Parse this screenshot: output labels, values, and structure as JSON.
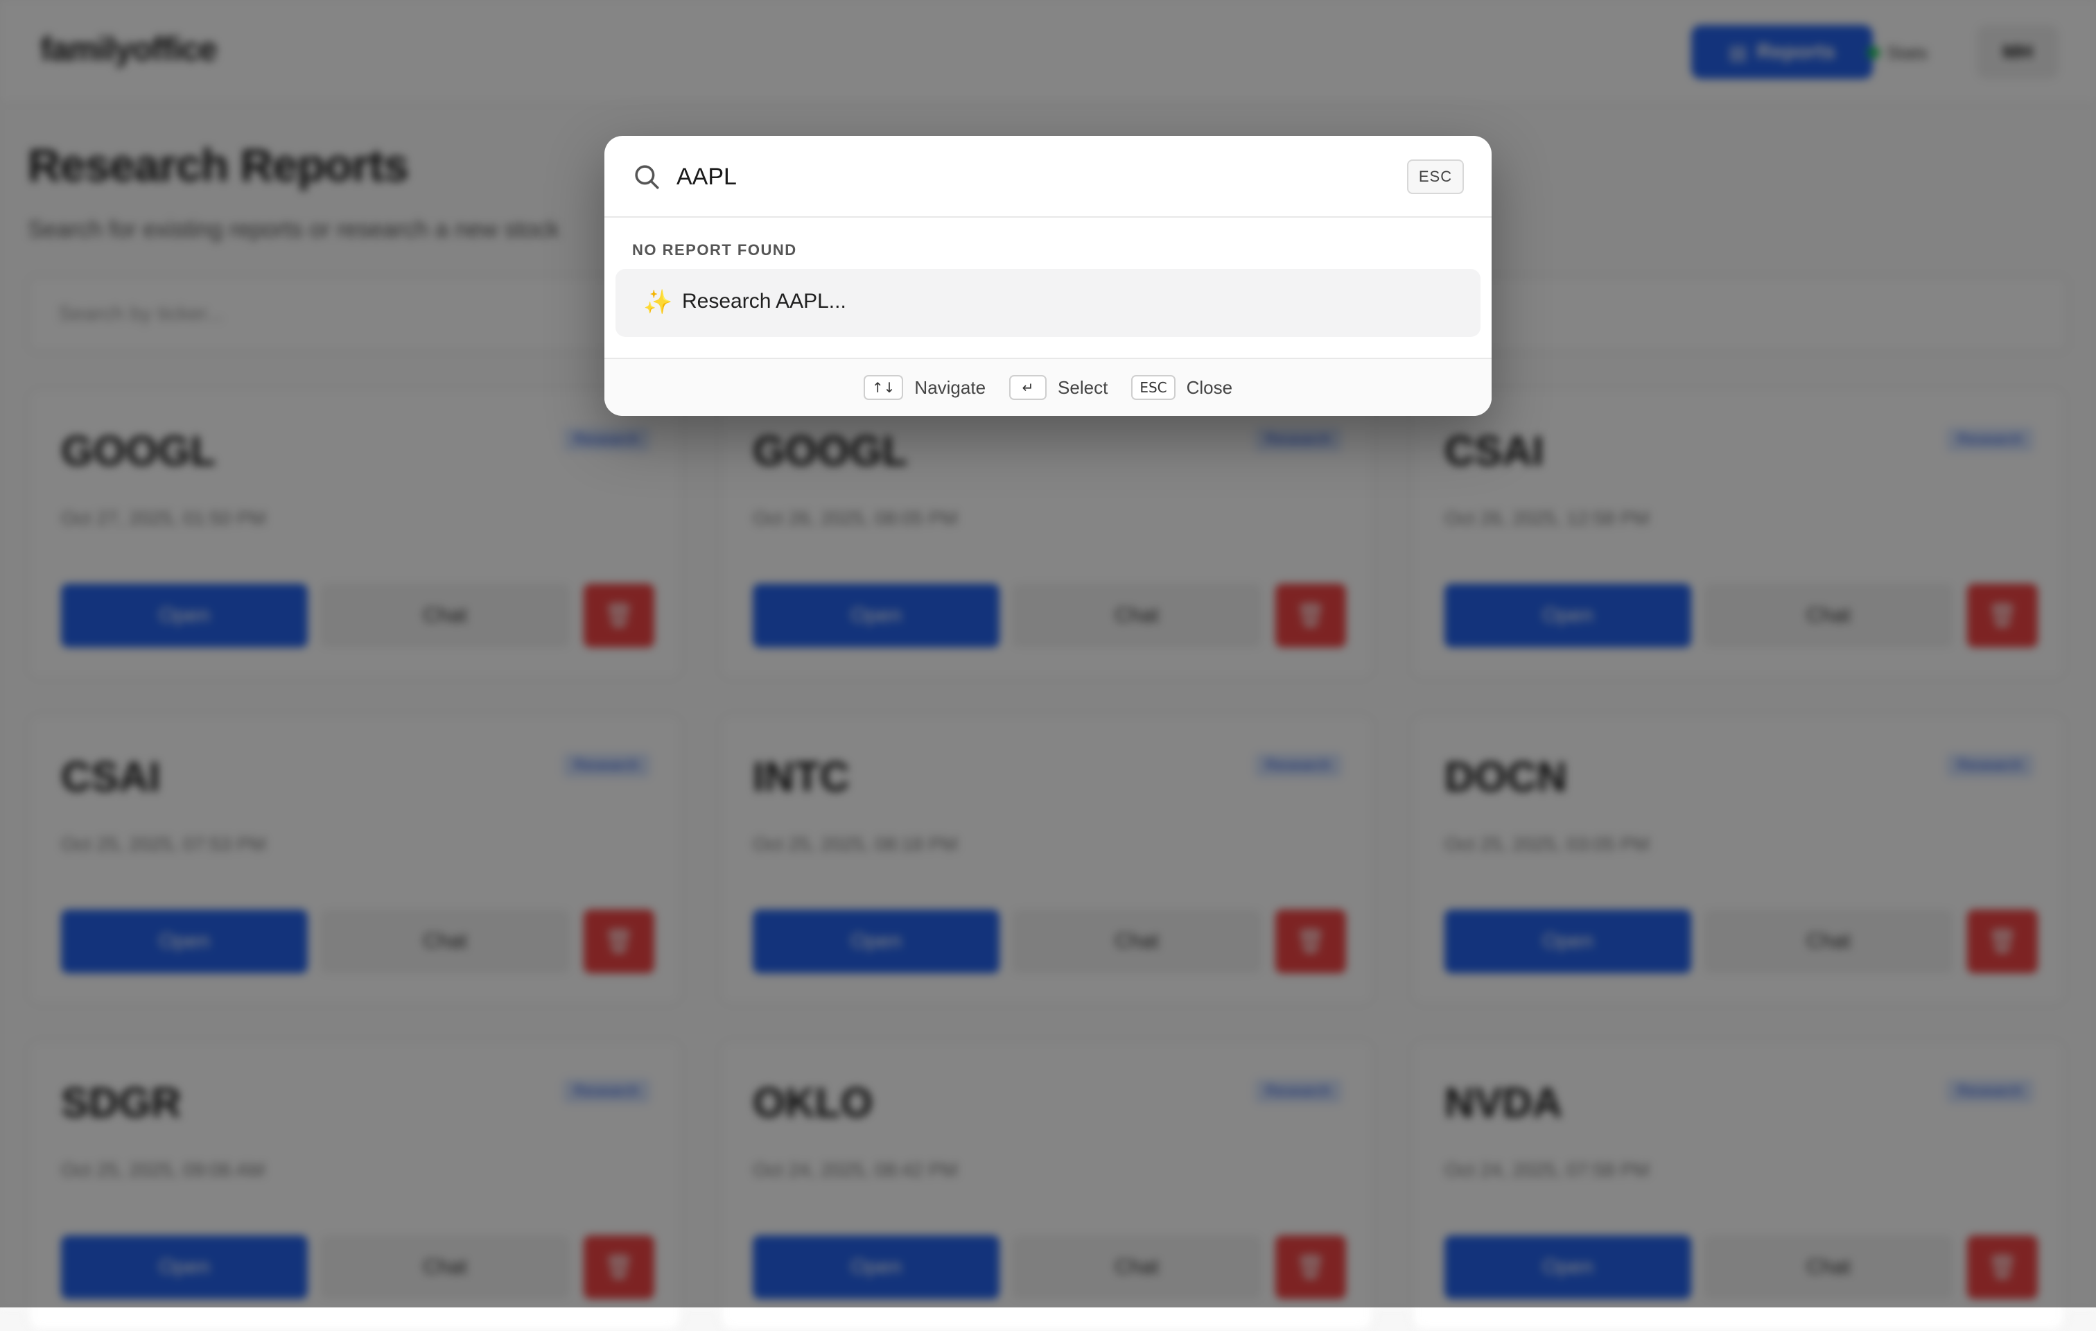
{
  "header": {
    "brand": "familyoffice",
    "reports_label": "Reports",
    "status_label": "Stats",
    "avatar_initials": "MH"
  },
  "page": {
    "title": "Research Reports",
    "subtitle": "Search for existing reports or research a new stock",
    "search_placeholder": "Search by ticker..."
  },
  "cards": [
    {
      "ticker": "GOOGL",
      "badge": "Research",
      "date": "Oct 27, 2025, 01:50 PM",
      "open": "Open",
      "chat": "Chat"
    },
    {
      "ticker": "GOOGL",
      "badge": "Research",
      "date": "Oct 26, 2025, 08:05 PM",
      "open": "Open",
      "chat": "Chat"
    },
    {
      "ticker": "CSAI",
      "badge": "Research",
      "date": "Oct 26, 2025, 12:58 PM",
      "open": "Open",
      "chat": "Chat"
    },
    {
      "ticker": "CSAI",
      "badge": "Research",
      "date": "Oct 25, 2025, 07:53 PM",
      "open": "Open",
      "chat": "Chat"
    },
    {
      "ticker": "INTC",
      "badge": "Research",
      "date": "Oct 25, 2025, 08:18 PM",
      "open": "Open",
      "chat": "Chat"
    },
    {
      "ticker": "DOCN",
      "badge": "Research",
      "date": "Oct 25, 2025, 03:05 PM",
      "open": "Open",
      "chat": "Chat"
    },
    {
      "ticker": "SDGR",
      "badge": "Research",
      "date": "Oct 25, 2025, 09:06 AM",
      "open": "Open",
      "chat": "Chat"
    },
    {
      "ticker": "OKLO",
      "badge": "Research",
      "date": "Oct 24, 2025, 08:42 PM",
      "open": "Open",
      "chat": "Chat"
    },
    {
      "ticker": "NVDA",
      "badge": "Research",
      "date": "Oct 24, 2025, 07:58 PM",
      "open": "Open",
      "chat": "Chat"
    }
  ],
  "palette": {
    "query": "AAPL",
    "esc_label": "ESC",
    "section_label": "NO REPORT FOUND",
    "result": {
      "icon": "sparkles-icon",
      "label": "Research AAPL..."
    },
    "footer": [
      {
        "key": "↑↓",
        "label": "Navigate"
      },
      {
        "key": "↵",
        "label": "Select"
      },
      {
        "key": "ESC",
        "label": "Close"
      }
    ]
  },
  "colors": {
    "primary": "#2563eb",
    "danger": "#ef4444",
    "overlay": "rgba(0,0,0,0.48)",
    "badge_bg": "#dbe7ff"
  }
}
